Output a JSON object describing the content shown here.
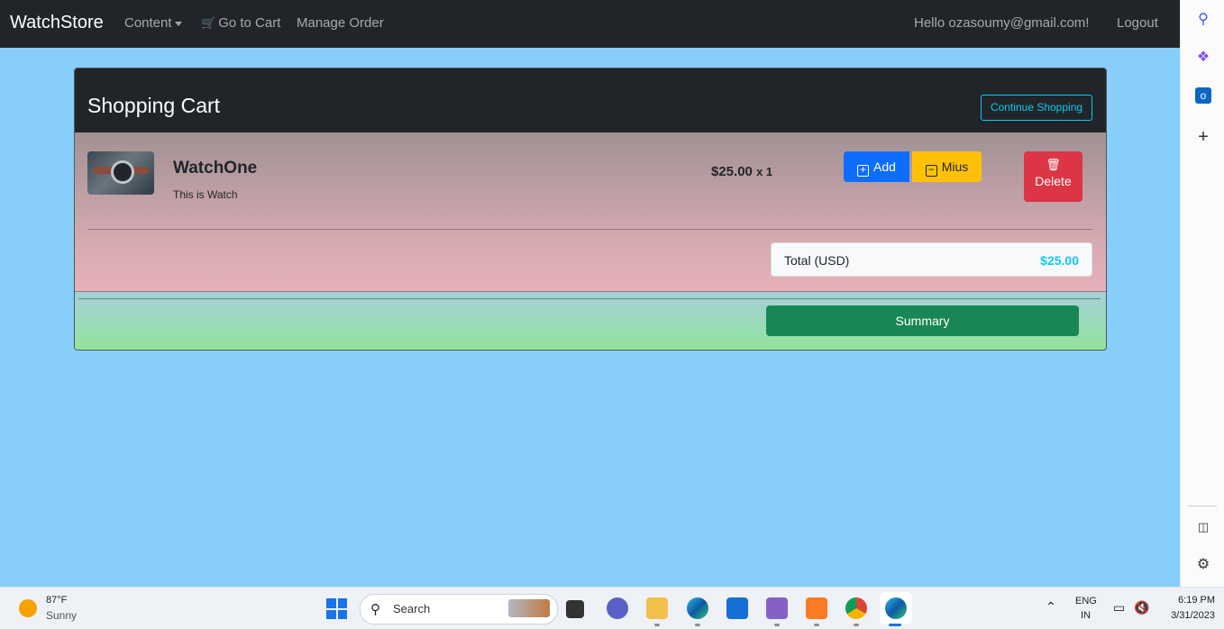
{
  "navbar": {
    "brand": "WatchStore",
    "content_label": "Content",
    "cart_icon": "cart-icon",
    "cart_label": "Go to Cart",
    "manage_order_label": "Manage Order",
    "greeting": "Hello ozasoumy@gmail.com!",
    "logout_label": "Logout"
  },
  "cart": {
    "title": "Shopping Cart",
    "continue_label": "Continue Shopping",
    "items": [
      {
        "name": "WatchOne",
        "description": "This is Watch",
        "price": "$25.00",
        "qty_text": "x 1",
        "add_label": "Add",
        "minus_label": "Mius",
        "delete_label": "Delete"
      }
    ],
    "total_label": "Total (USD)",
    "total_value": "$25.00",
    "summary_label": "Summary"
  },
  "colors": {
    "page_bg": "#87cefa",
    "navbar_bg": "#212529",
    "add_btn": "#0d6efd",
    "minus_btn": "#ffc107",
    "delete_btn": "#dc3545",
    "summary_btn": "#198754",
    "accent_cyan": "#0dcaf0"
  },
  "edge_sidebar": {
    "icons": [
      "search-icon",
      "copilot-icon",
      "outlook-icon",
      "add-icon",
      "sidebar-toggle-icon",
      "settings-icon"
    ]
  },
  "taskbar": {
    "temperature": "87°F",
    "condition": "Sunny",
    "search_placeholder": "Search",
    "apps": [
      "task-view-icon",
      "teams-chat-icon",
      "file-explorer-icon",
      "edge-icon",
      "store-icon",
      "visual-studio-icon",
      "xampp-icon",
      "chrome-icon",
      "edge-active-icon"
    ],
    "lang_line1": "ENG",
    "lang_line2": "IN",
    "time": "6:19 PM",
    "date": "3/31/2023"
  }
}
